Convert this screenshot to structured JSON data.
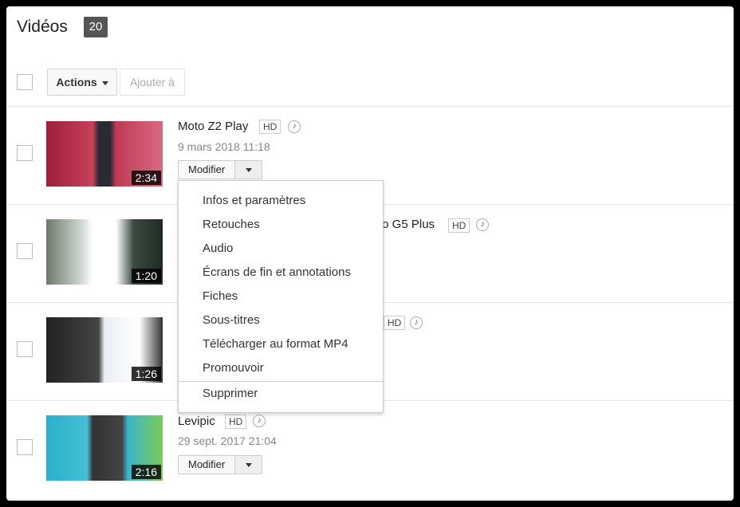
{
  "header": {
    "title": "Vidéos",
    "count": "20"
  },
  "toolbar": {
    "actions_label": "Actions",
    "add_to_label": "Ajouter à"
  },
  "videos": [
    {
      "title": "Moto Z2 Play",
      "hd": "HD",
      "date": "9 mars 2018 11:18",
      "duration": "2:34",
      "edit_label": "Modifier",
      "thumb": "#b02a4a"
    },
    {
      "title": "to G5 Plus",
      "hd": "HD",
      "duration": "1:20",
      "thumb": "#4a5a4a"
    },
    {
      "hd": "HD",
      "duration": "1:26",
      "thumb": "#222831"
    },
    {
      "title": "Levipic",
      "hd": "HD",
      "date": "29 sept. 2017 21:04",
      "duration": "2:16",
      "edit_label": "Modifier",
      "thumb": "#2aa7c0"
    }
  ],
  "menu": {
    "items": [
      "Infos et paramètres",
      "Retouches",
      "Audio",
      "Écrans de fin et annotations",
      "Fiches",
      "Sous-titres",
      "Télécharger au format MP4",
      "Promouvoir"
    ],
    "delete": "Supprimer"
  }
}
